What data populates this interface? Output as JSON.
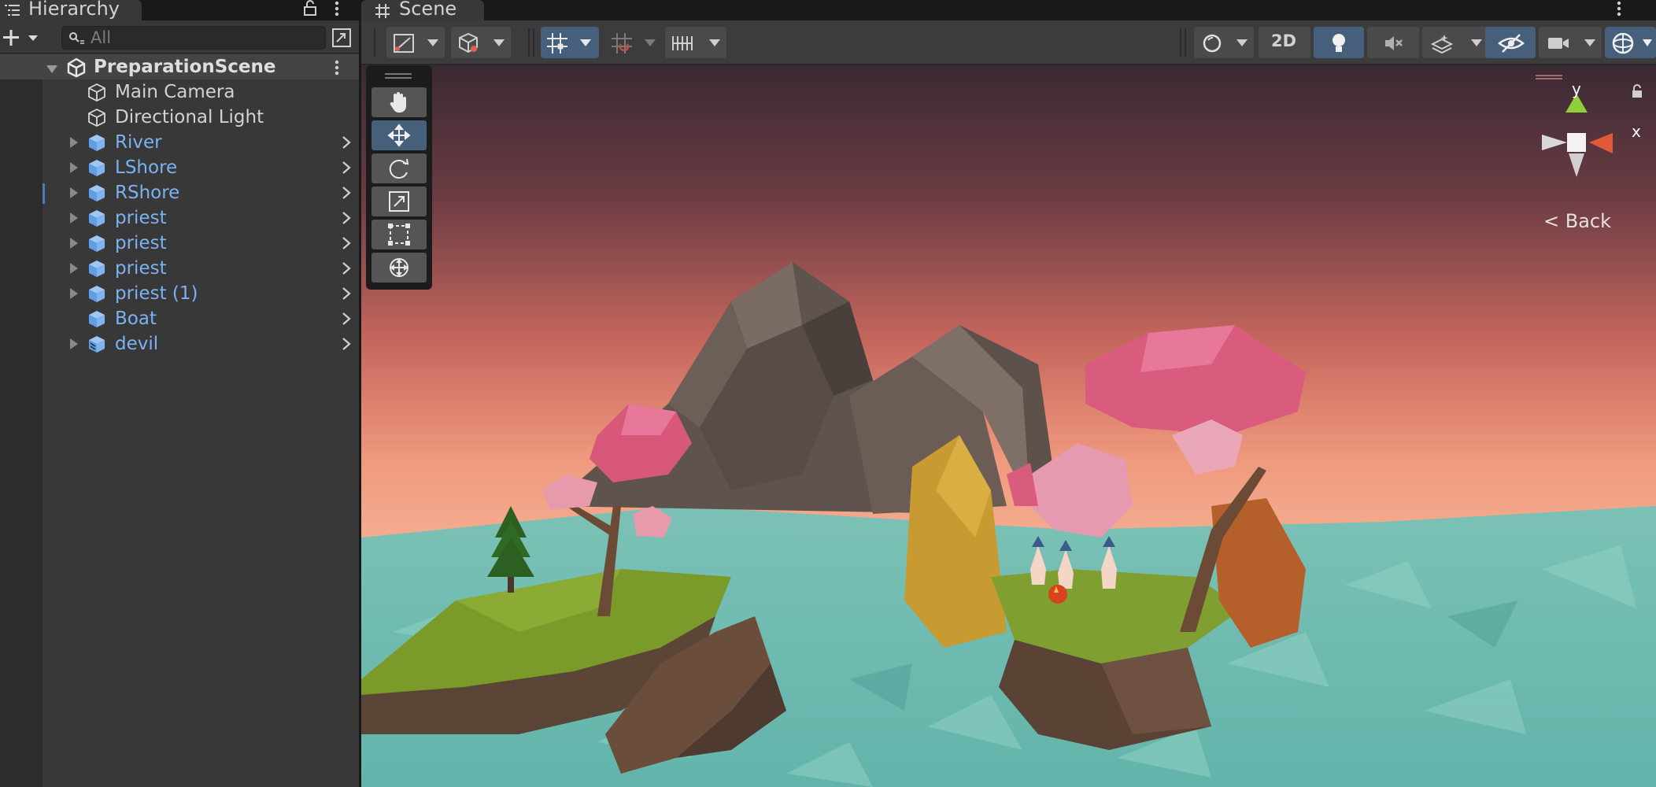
{
  "hierarchy": {
    "tab_label": "Hierarchy",
    "search_placeholder": "All",
    "scene_name": "PreparationScene",
    "items": [
      {
        "label": "Main Camera",
        "kind": "plain",
        "expandable": false,
        "chevron": false
      },
      {
        "label": "Directional Light",
        "kind": "plain",
        "expandable": false,
        "chevron": false
      },
      {
        "label": "River",
        "kind": "prefab",
        "expandable": true,
        "chevron": true
      },
      {
        "label": "LShore",
        "kind": "prefab",
        "expandable": true,
        "chevron": true
      },
      {
        "label": "RShore",
        "kind": "prefab",
        "expandable": true,
        "chevron": true
      },
      {
        "label": "priest",
        "kind": "prefab",
        "expandable": true,
        "chevron": true
      },
      {
        "label": "priest",
        "kind": "prefab",
        "expandable": true,
        "chevron": true
      },
      {
        "label": "priest",
        "kind": "prefab",
        "expandable": true,
        "chevron": true
      },
      {
        "label": "priest (1)",
        "kind": "prefab",
        "expandable": true,
        "chevron": true
      },
      {
        "label": "Boat",
        "kind": "prefab",
        "expandable": false,
        "chevron": true
      },
      {
        "label": "devil",
        "kind": "prefab-variant",
        "expandable": true,
        "chevron": true
      }
    ]
  },
  "scene": {
    "tab_label": "Scene",
    "toolbar": {
      "toggle_2d_label": "2D",
      "buttons": [
        "draw-mode",
        "shading-mode",
        "grid-snap",
        "increment-snap",
        "rulers",
        "render-mode",
        "2d-toggle",
        "lighting",
        "audio",
        "effects",
        "hidden-objects",
        "camera",
        "gizmos"
      ]
    },
    "tools": [
      "hand-tool",
      "move-tool",
      "rotate-tool",
      "scale-tool",
      "rect-tool",
      "transform-tool"
    ],
    "selected_tool": "move-tool",
    "gizmo": {
      "y_label": "y",
      "x_label": "x",
      "view_label": "< Back"
    }
  },
  "colors": {
    "prefab_text": "#7bb2f3",
    "active_button": "#46607c",
    "panel_bg": "#383838",
    "gizmo_y": "#8fcf3a",
    "gizmo_x": "#e05a3a"
  }
}
